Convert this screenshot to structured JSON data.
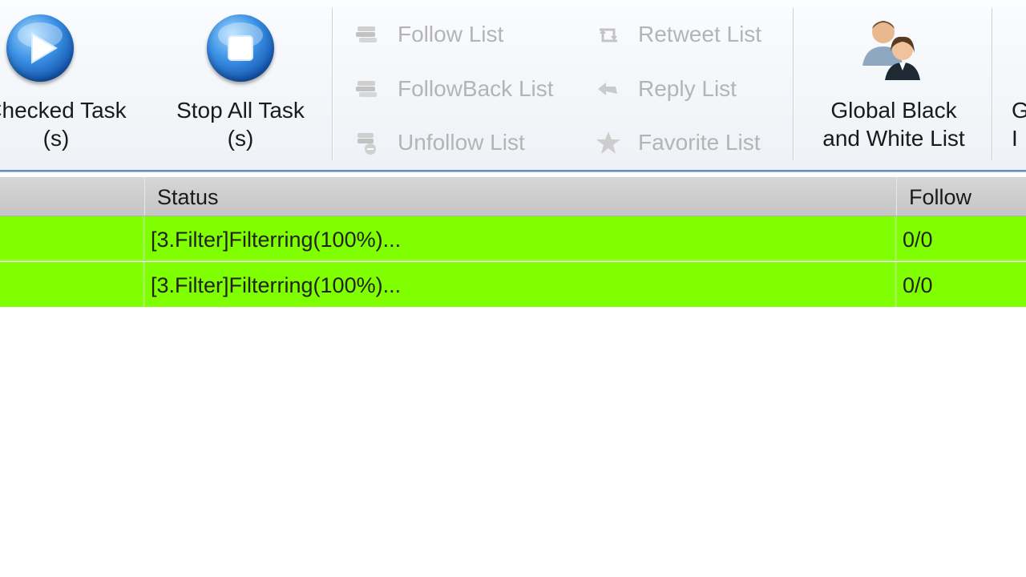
{
  "ribbon": {
    "start_checked": {
      "label_line1": "Checked Task",
      "label_line2": "(s)",
      "icon": "play-icon"
    },
    "stop_all": {
      "label_line1": "Stop All Task",
      "label_line2": "(s)",
      "icon": "stop-icon"
    },
    "lists": {
      "follow_list": "Follow List",
      "followback_list": "FollowBack List",
      "unfollow_list": "Unfollow List",
      "retweet_list": "Retweet List",
      "reply_list": "Reply List",
      "favorite_list": "Favorite List"
    },
    "global_list": {
      "label_line1": "Global Black",
      "label_line2": "and White List",
      "icon": "users-icon"
    },
    "partial_next": {
      "label_line1": "G",
      "label_line2": "I"
    }
  },
  "grid": {
    "columns": {
      "status": "Status",
      "follow": "Follow"
    },
    "rows": [
      {
        "status": "[3.Filter]Filterring(100%)...",
        "follow": "0/0"
      },
      {
        "status": "[3.Filter]Filterring(100%)...",
        "follow": "0/0"
      }
    ]
  },
  "colors": {
    "row_highlight": "#7fff00",
    "header_bg": "#c8c8c8",
    "disabled_text": "#b4b4b4",
    "ribbon_border": "#5f8fbd"
  }
}
